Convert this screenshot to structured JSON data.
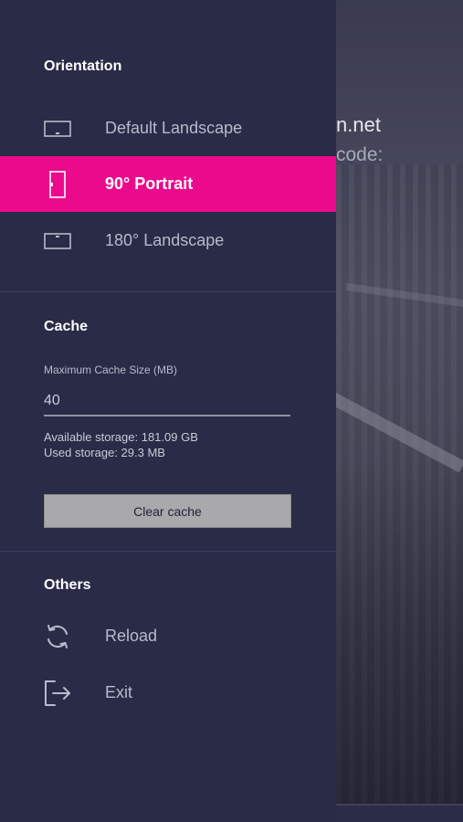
{
  "background": {
    "line1": "n.net",
    "line2": "code:"
  },
  "drawer": {
    "orientation": {
      "title": "Orientation",
      "items": [
        {
          "label": "Default Landscape",
          "icon": "landscape-icon",
          "selected": false
        },
        {
          "label": "90° Portrait",
          "icon": "portrait-icon",
          "selected": true
        },
        {
          "label": "180° Landscape",
          "icon": "landscape-flipped-icon",
          "selected": false
        }
      ]
    },
    "cache": {
      "title": "Cache",
      "max_label": "Maximum Cache Size (MB)",
      "max_value": "40",
      "available": "Available storage: 181.09 GB",
      "used": "Used storage: 29.3 MB",
      "clear_label": "Clear cache"
    },
    "others": {
      "title": "Others",
      "items": [
        {
          "label": "Reload",
          "icon": "reload-icon"
        },
        {
          "label": "Exit",
          "icon": "exit-icon"
        }
      ]
    }
  },
  "colors": {
    "drawer_bg": "#2a2b47",
    "accent": "#ec0a8c",
    "button_bg": "#a9a9ab"
  }
}
